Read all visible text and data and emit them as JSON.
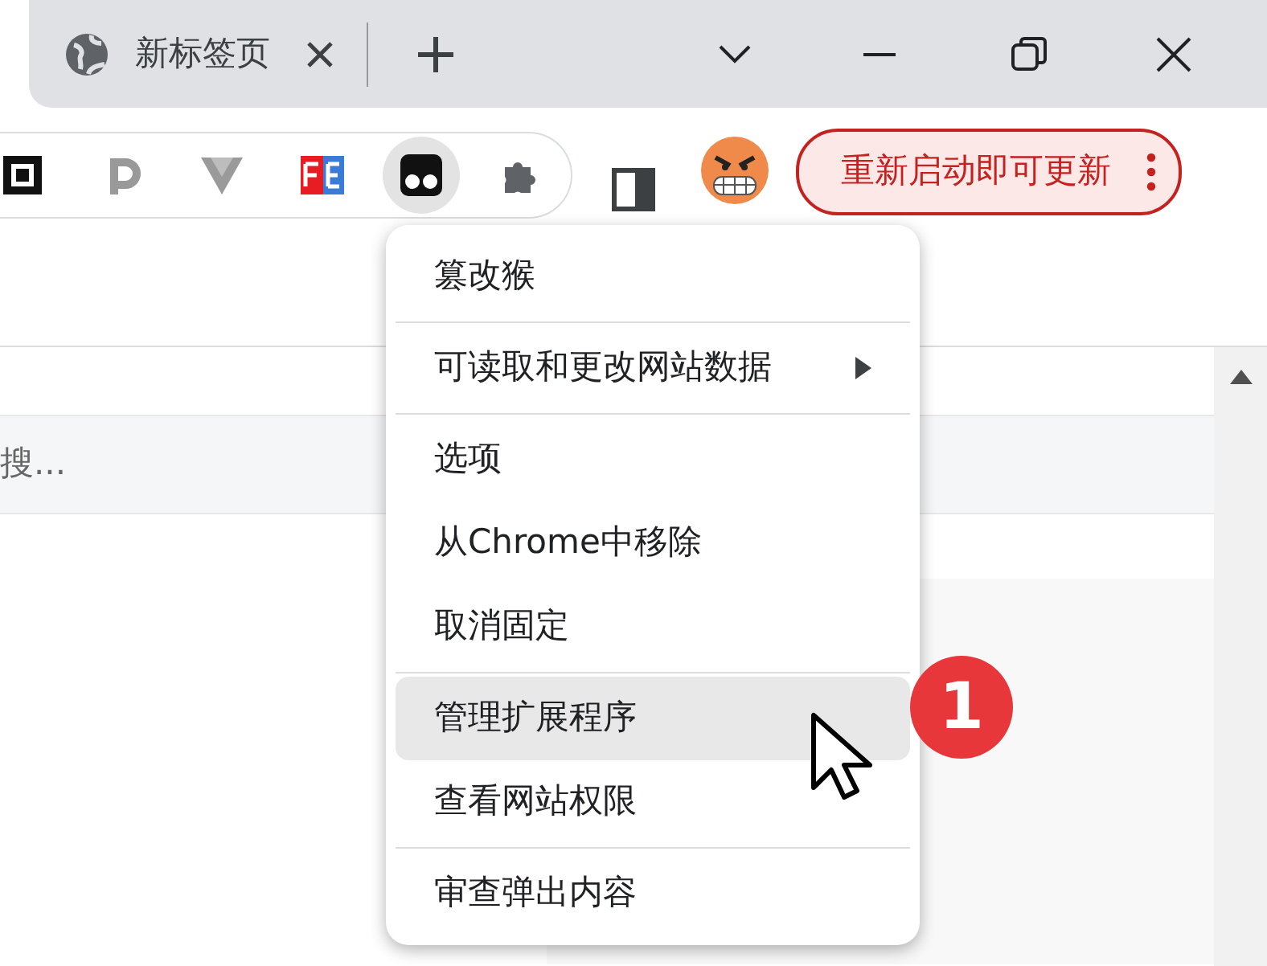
{
  "tab": {
    "title": "新标签页"
  },
  "extensions": [
    {
      "kind": "square",
      "selected": false
    },
    {
      "kind": "p",
      "selected": false
    },
    {
      "kind": "v",
      "selected": false
    },
    {
      "kind": "fe",
      "selected": false
    },
    {
      "kind": "monkey",
      "selected": true
    },
    {
      "kind": "puzzle",
      "selected": false
    }
  ],
  "update_button": {
    "label": "重新启动即可更新"
  },
  "search": {
    "placeholder": "搜..."
  },
  "menu": {
    "items": [
      {
        "kind": "header",
        "label": "篡改猴"
      },
      {
        "kind": "divider"
      },
      {
        "kind": "submenu",
        "label": "可读取和更改网站数据",
        "hovered": false
      },
      {
        "kind": "divider"
      },
      {
        "kind": "item",
        "label": "选项",
        "hovered": false
      },
      {
        "kind": "item",
        "label": "从Chrome中移除",
        "hovered": false
      },
      {
        "kind": "item",
        "label": "取消固定",
        "hovered": false
      },
      {
        "kind": "divider"
      },
      {
        "kind": "item",
        "label": "管理扩展程序",
        "hovered": true
      },
      {
        "kind": "item",
        "label": "查看网站权限",
        "hovered": false
      },
      {
        "kind": "divider"
      },
      {
        "kind": "item",
        "label": "审查弹出内容",
        "hovered": false
      }
    ]
  },
  "step_badge": {
    "text": "1"
  }
}
